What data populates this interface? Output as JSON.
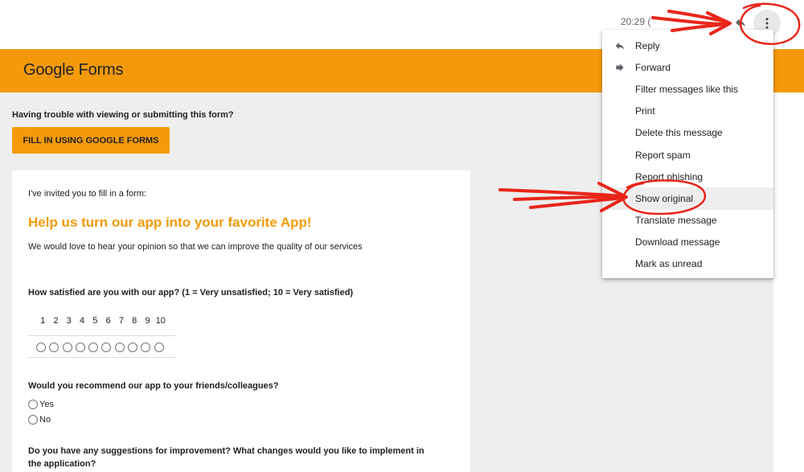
{
  "email": {
    "timestamp": "20:29 (",
    "reply_icon": "reply-arrow-icon",
    "more_icon": "more-vertical-icon"
  },
  "banner": {
    "logo": "Google Forms",
    "color": "#f49a0a"
  },
  "body": {
    "trouble_text": "Having trouble with viewing or submitting this form?",
    "fill_button": "FILL IN USING GOOGLE FORMS"
  },
  "form": {
    "invited": "I've invited you to fill in a form:",
    "title": "Help us turn our app into your favorite App!",
    "description": "We would love to hear your opinion so that we can improve the quality of our services",
    "q1": "How satisfied are you with our app? (1 = Very unsatisfied; 10 = Very satisfied)",
    "scale": [
      "1",
      "2",
      "3",
      "4",
      "5",
      "6",
      "7",
      "8",
      "9",
      "10"
    ],
    "q2": "Would you recommend our app to your friends/colleagues?",
    "options": [
      "Yes",
      "No"
    ],
    "q3": "Do you have any suggestions for improvement? What changes would you like to implement in the application?"
  },
  "menu": {
    "items": [
      {
        "label": "Reply",
        "icon": "reply-icon"
      },
      {
        "label": "Forward",
        "icon": "forward-icon"
      },
      {
        "label": "Filter messages like this"
      },
      {
        "label": "Print"
      },
      {
        "label": "Delete this message"
      },
      {
        "label": "Report spam"
      },
      {
        "label": "Report phishing"
      },
      {
        "label": "Show original"
      },
      {
        "label": "Translate message"
      },
      {
        "label": "Download message"
      },
      {
        "label": "Mark as unread"
      }
    ],
    "highlighted": "Show original"
  },
  "annotation_color": "#e8261a"
}
